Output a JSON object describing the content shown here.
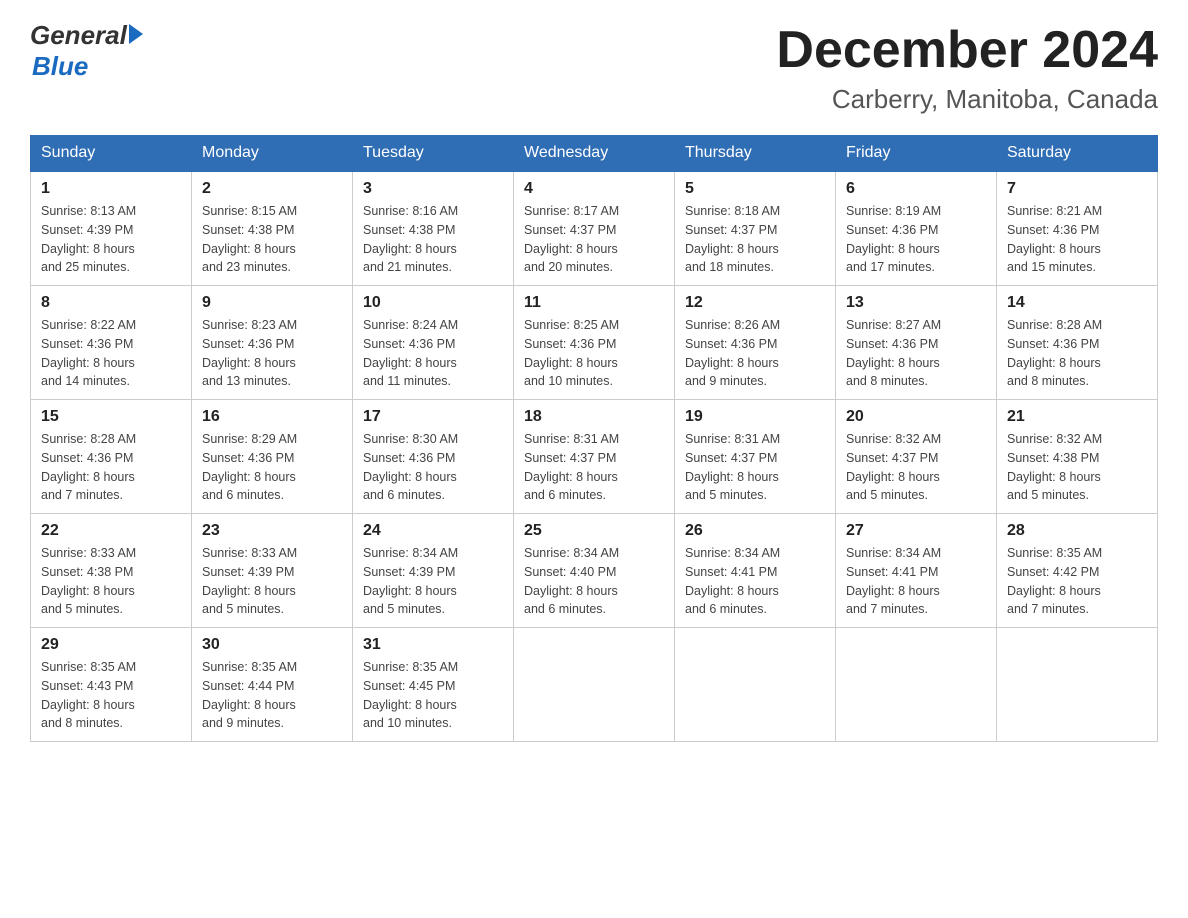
{
  "header": {
    "logo_general": "General",
    "logo_blue": "Blue",
    "month_title": "December 2024",
    "location": "Carberry, Manitoba, Canada"
  },
  "days_of_week": [
    "Sunday",
    "Monday",
    "Tuesday",
    "Wednesday",
    "Thursday",
    "Friday",
    "Saturday"
  ],
  "weeks": [
    [
      {
        "day": "1",
        "sunrise": "8:13 AM",
        "sunset": "4:39 PM",
        "daylight": "8 hours and 25 minutes."
      },
      {
        "day": "2",
        "sunrise": "8:15 AM",
        "sunset": "4:38 PM",
        "daylight": "8 hours and 23 minutes."
      },
      {
        "day": "3",
        "sunrise": "8:16 AM",
        "sunset": "4:38 PM",
        "daylight": "8 hours and 21 minutes."
      },
      {
        "day": "4",
        "sunrise": "8:17 AM",
        "sunset": "4:37 PM",
        "daylight": "8 hours and 20 minutes."
      },
      {
        "day": "5",
        "sunrise": "8:18 AM",
        "sunset": "4:37 PM",
        "daylight": "8 hours and 18 minutes."
      },
      {
        "day": "6",
        "sunrise": "8:19 AM",
        "sunset": "4:36 PM",
        "daylight": "8 hours and 17 minutes."
      },
      {
        "day": "7",
        "sunrise": "8:21 AM",
        "sunset": "4:36 PM",
        "daylight": "8 hours and 15 minutes."
      }
    ],
    [
      {
        "day": "8",
        "sunrise": "8:22 AM",
        "sunset": "4:36 PM",
        "daylight": "8 hours and 14 minutes."
      },
      {
        "day": "9",
        "sunrise": "8:23 AM",
        "sunset": "4:36 PM",
        "daylight": "8 hours and 13 minutes."
      },
      {
        "day": "10",
        "sunrise": "8:24 AM",
        "sunset": "4:36 PM",
        "daylight": "8 hours and 11 minutes."
      },
      {
        "day": "11",
        "sunrise": "8:25 AM",
        "sunset": "4:36 PM",
        "daylight": "8 hours and 10 minutes."
      },
      {
        "day": "12",
        "sunrise": "8:26 AM",
        "sunset": "4:36 PM",
        "daylight": "8 hours and 9 minutes."
      },
      {
        "day": "13",
        "sunrise": "8:27 AM",
        "sunset": "4:36 PM",
        "daylight": "8 hours and 8 minutes."
      },
      {
        "day": "14",
        "sunrise": "8:28 AM",
        "sunset": "4:36 PM",
        "daylight": "8 hours and 8 minutes."
      }
    ],
    [
      {
        "day": "15",
        "sunrise": "8:28 AM",
        "sunset": "4:36 PM",
        "daylight": "8 hours and 7 minutes."
      },
      {
        "day": "16",
        "sunrise": "8:29 AM",
        "sunset": "4:36 PM",
        "daylight": "8 hours and 6 minutes."
      },
      {
        "day": "17",
        "sunrise": "8:30 AM",
        "sunset": "4:36 PM",
        "daylight": "8 hours and 6 minutes."
      },
      {
        "day": "18",
        "sunrise": "8:31 AM",
        "sunset": "4:37 PM",
        "daylight": "8 hours and 6 minutes."
      },
      {
        "day": "19",
        "sunrise": "8:31 AM",
        "sunset": "4:37 PM",
        "daylight": "8 hours and 5 minutes."
      },
      {
        "day": "20",
        "sunrise": "8:32 AM",
        "sunset": "4:37 PM",
        "daylight": "8 hours and 5 minutes."
      },
      {
        "day": "21",
        "sunrise": "8:32 AM",
        "sunset": "4:38 PM",
        "daylight": "8 hours and 5 minutes."
      }
    ],
    [
      {
        "day": "22",
        "sunrise": "8:33 AM",
        "sunset": "4:38 PM",
        "daylight": "8 hours and 5 minutes."
      },
      {
        "day": "23",
        "sunrise": "8:33 AM",
        "sunset": "4:39 PM",
        "daylight": "8 hours and 5 minutes."
      },
      {
        "day": "24",
        "sunrise": "8:34 AM",
        "sunset": "4:39 PM",
        "daylight": "8 hours and 5 minutes."
      },
      {
        "day": "25",
        "sunrise": "8:34 AM",
        "sunset": "4:40 PM",
        "daylight": "8 hours and 6 minutes."
      },
      {
        "day": "26",
        "sunrise": "8:34 AM",
        "sunset": "4:41 PM",
        "daylight": "8 hours and 6 minutes."
      },
      {
        "day": "27",
        "sunrise": "8:34 AM",
        "sunset": "4:41 PM",
        "daylight": "8 hours and 7 minutes."
      },
      {
        "day": "28",
        "sunrise": "8:35 AM",
        "sunset": "4:42 PM",
        "daylight": "8 hours and 7 minutes."
      }
    ],
    [
      {
        "day": "29",
        "sunrise": "8:35 AM",
        "sunset": "4:43 PM",
        "daylight": "8 hours and 8 minutes."
      },
      {
        "day": "30",
        "sunrise": "8:35 AM",
        "sunset": "4:44 PM",
        "daylight": "8 hours and 9 minutes."
      },
      {
        "day": "31",
        "sunrise": "8:35 AM",
        "sunset": "4:45 PM",
        "daylight": "8 hours and 10 minutes."
      },
      null,
      null,
      null,
      null
    ]
  ],
  "labels": {
    "sunrise": "Sunrise:",
    "sunset": "Sunset:",
    "daylight": "Daylight:"
  }
}
